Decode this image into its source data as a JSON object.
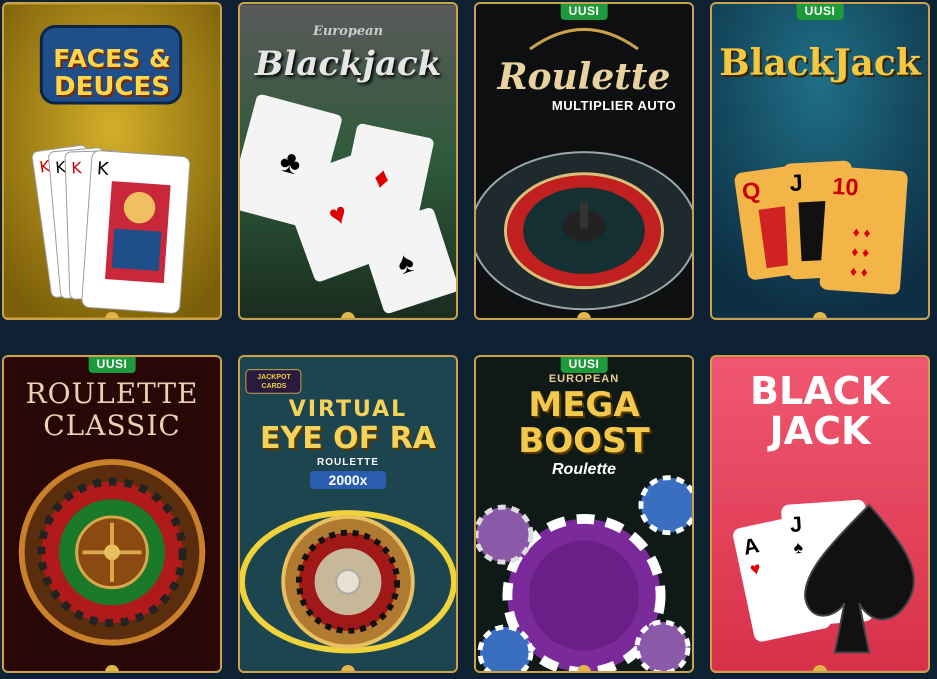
{
  "colors": {
    "background": "#0f2233",
    "card_border": "#c9a24a",
    "badge_bg": "#1e9a3a"
  },
  "games": [
    {
      "title_line1": "FACES &",
      "title_line2": "DEUCES",
      "badge": ""
    },
    {
      "title_small": "European",
      "title": "Blackjack",
      "badge": ""
    },
    {
      "title": "Roulette",
      "subtitle": "MULTIPLIER AUTO",
      "badge": "UUSI"
    },
    {
      "title": "BlackJack",
      "badge": "UUSI"
    },
    {
      "title_line1": "ROULETTE",
      "title_line2": "CLASSIC",
      "badge": "UUSI"
    },
    {
      "logo": "JACKPOT CARDS",
      "title_line1": "VIRTUAL",
      "title_line2": "EYE OF RA",
      "subtitle": "ROULETTE",
      "multiplier": "2000x",
      "badge": ""
    },
    {
      "title_small": "EUROPEAN",
      "title_line1": "MEGA",
      "title_line2": "BOOST",
      "subtitle": "Roulette",
      "badge": "UUSI"
    },
    {
      "title_line1": "BLACK",
      "title_line2": "JACK",
      "badge": ""
    }
  ]
}
